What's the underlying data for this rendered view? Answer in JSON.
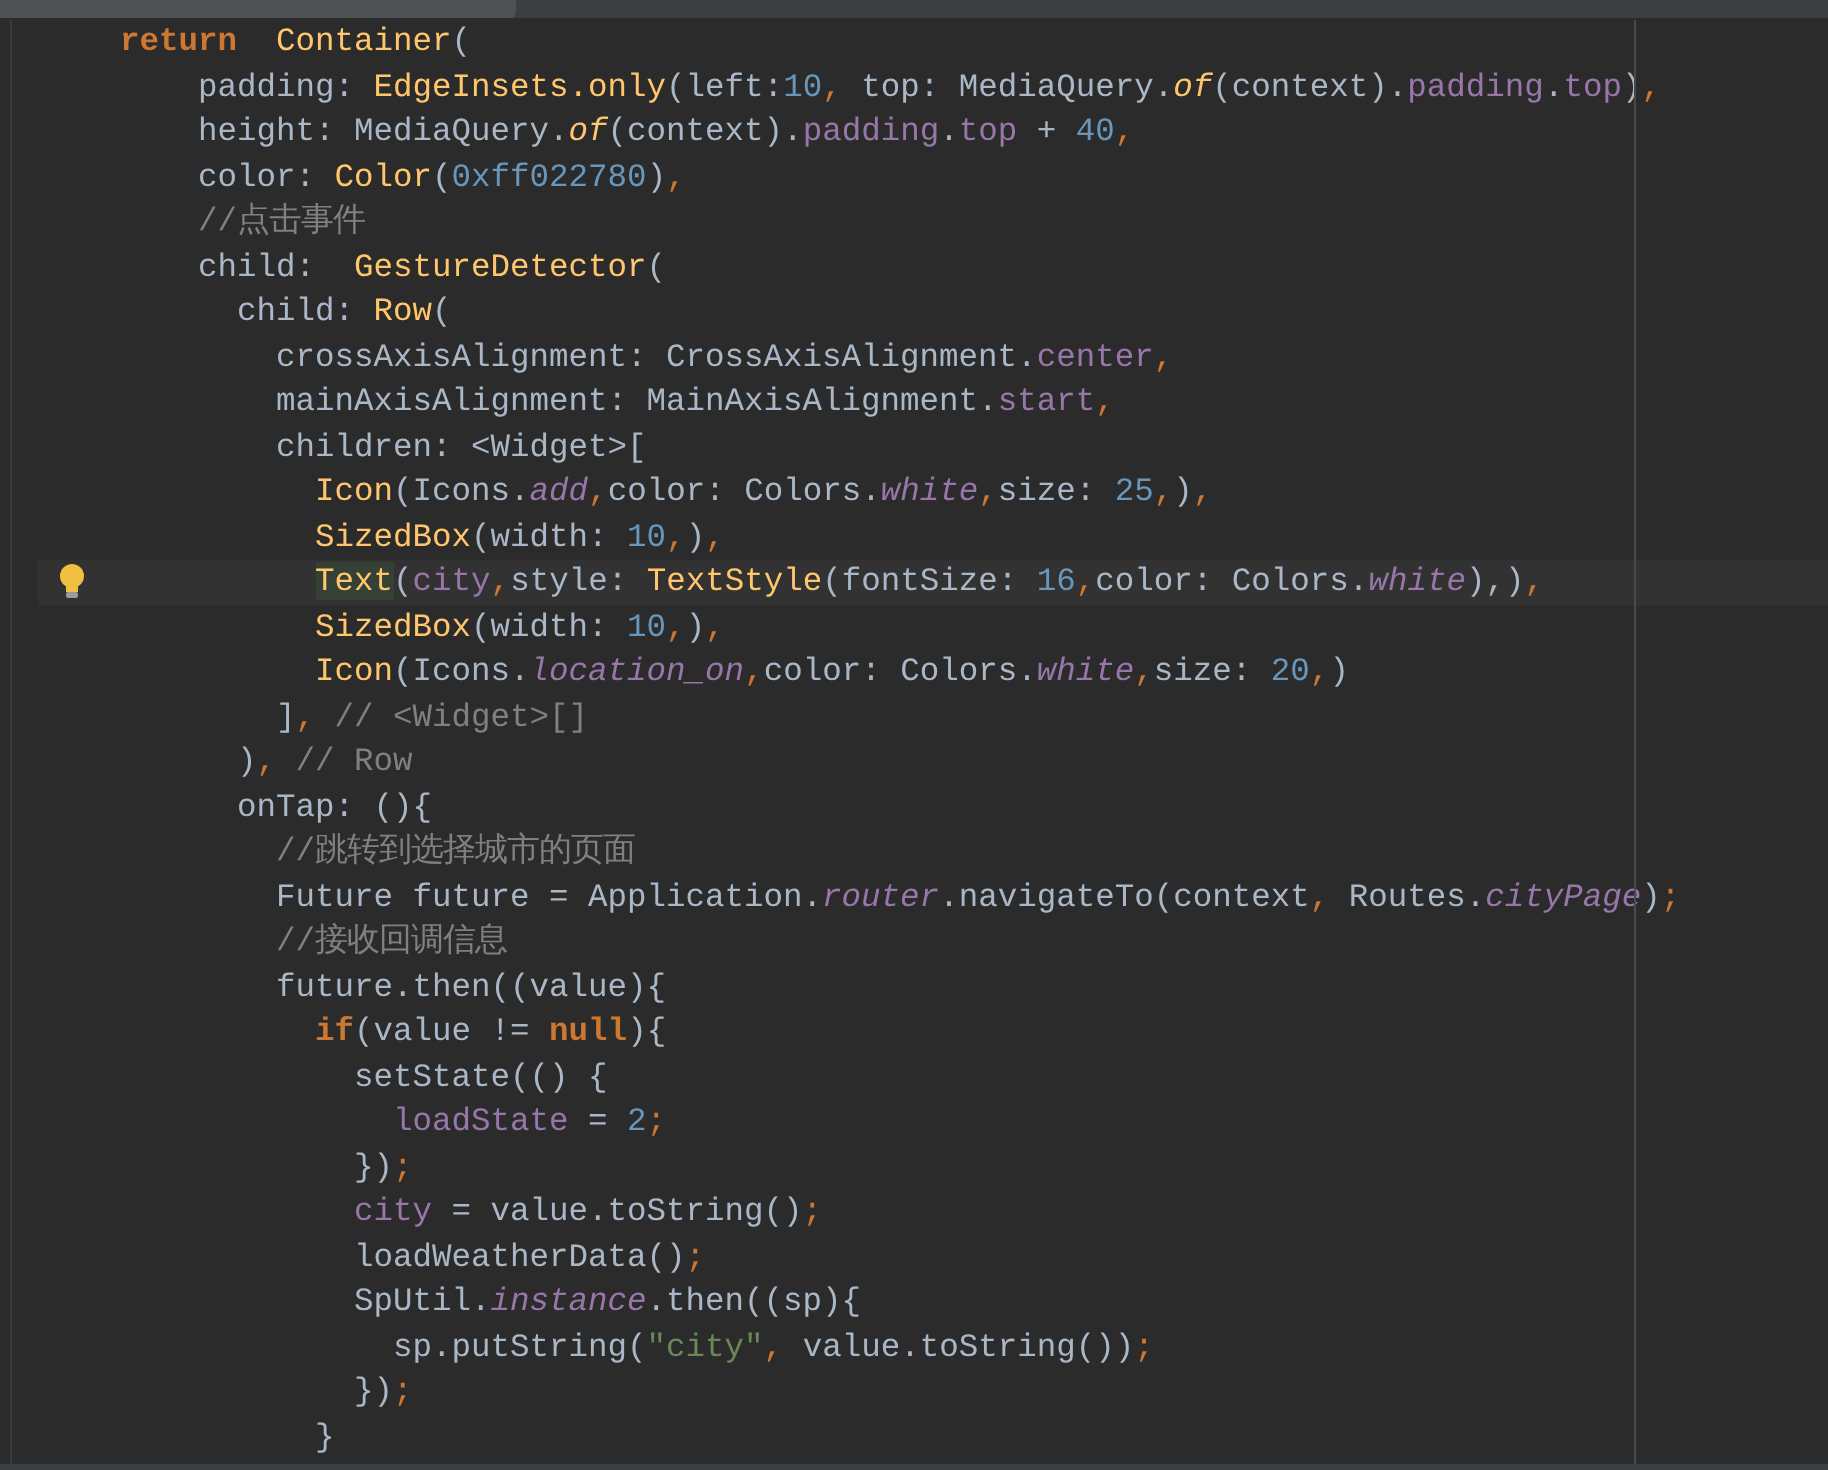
{
  "editor": {
    "lines": [
      {
        "current": false,
        "tokens": [
          {
            "kind": "keyword",
            "text": "    return"
          },
          {
            "kind": "class",
            "text": "  Container"
          },
          {
            "kind": "plain",
            "text": "("
          }
        ]
      },
      {
        "current": false,
        "tokens": [
          {
            "kind": "plain",
            "text": "        padding: "
          },
          {
            "kind": "class",
            "text": "EdgeInsets.only"
          },
          {
            "kind": "plain",
            "text": "(left:"
          },
          {
            "kind": "number",
            "text": "10"
          },
          {
            "kind": "punct",
            "text": ","
          },
          {
            "kind": "plain",
            "text": " top: MediaQuery."
          },
          {
            "kind": "method",
            "text": "of"
          },
          {
            "kind": "plain",
            "text": "(context)."
          },
          {
            "kind": "field",
            "text": "padding"
          },
          {
            "kind": "plain",
            "text": "."
          },
          {
            "kind": "field",
            "text": "top"
          },
          {
            "kind": "plain",
            "text": ")"
          },
          {
            "kind": "punct",
            "text": ","
          }
        ]
      },
      {
        "current": false,
        "tokens": [
          {
            "kind": "plain",
            "text": "        height: MediaQuery."
          },
          {
            "kind": "method",
            "text": "of"
          },
          {
            "kind": "plain",
            "text": "(context)."
          },
          {
            "kind": "field",
            "text": "padding"
          },
          {
            "kind": "plain",
            "text": "."
          },
          {
            "kind": "field",
            "text": "top"
          },
          {
            "kind": "plain",
            "text": " + "
          },
          {
            "kind": "number",
            "text": "40"
          },
          {
            "kind": "punct",
            "text": ","
          }
        ]
      },
      {
        "current": false,
        "tokens": [
          {
            "kind": "plain",
            "text": "        color: "
          },
          {
            "kind": "class",
            "text": "Color"
          },
          {
            "kind": "plain",
            "text": "("
          },
          {
            "kind": "number",
            "text": "0xff022780"
          },
          {
            "kind": "plain",
            "text": ")"
          },
          {
            "kind": "punct",
            "text": ","
          }
        ]
      },
      {
        "current": false,
        "tokens": [
          {
            "kind": "comment",
            "text": "        //点击事件"
          }
        ]
      },
      {
        "current": false,
        "tokens": [
          {
            "kind": "plain",
            "text": "        child:  "
          },
          {
            "kind": "class",
            "text": "GestureDetector"
          },
          {
            "kind": "plain",
            "text": "("
          }
        ]
      },
      {
        "current": false,
        "tokens": [
          {
            "kind": "plain",
            "text": "          child: "
          },
          {
            "kind": "class",
            "text": "Row"
          },
          {
            "kind": "plain",
            "text": "("
          }
        ]
      },
      {
        "current": false,
        "tokens": [
          {
            "kind": "plain",
            "text": "            crossAxisAlignment: CrossAxisAlignment."
          },
          {
            "kind": "field",
            "text": "center"
          },
          {
            "kind": "punct",
            "text": ","
          }
        ]
      },
      {
        "current": false,
        "tokens": [
          {
            "kind": "plain",
            "text": "            mainAxisAlignment: MainAxisAlignment."
          },
          {
            "kind": "field",
            "text": "start"
          },
          {
            "kind": "punct",
            "text": ","
          }
        ]
      },
      {
        "current": false,
        "tokens": [
          {
            "kind": "plain",
            "text": "            children: <Widget>["
          }
        ]
      },
      {
        "current": false,
        "tokens": [
          {
            "kind": "class",
            "text": "              Icon"
          },
          {
            "kind": "plain",
            "text": "(Icons."
          },
          {
            "kind": "static",
            "text": "add"
          },
          {
            "kind": "punct",
            "text": ","
          },
          {
            "kind": "plain",
            "text": "color: Colors."
          },
          {
            "kind": "static",
            "text": "white"
          },
          {
            "kind": "punct",
            "text": ","
          },
          {
            "kind": "plain",
            "text": "size: "
          },
          {
            "kind": "number",
            "text": "25"
          },
          {
            "kind": "punct",
            "text": ","
          },
          {
            "kind": "plain",
            "text": ")"
          },
          {
            "kind": "punct",
            "text": ","
          }
        ]
      },
      {
        "current": false,
        "tokens": [
          {
            "kind": "class",
            "text": "              SizedBox"
          },
          {
            "kind": "plain",
            "text": "(width: "
          },
          {
            "kind": "number",
            "text": "10"
          },
          {
            "kind": "punct",
            "text": ","
          },
          {
            "kind": "plain",
            "text": ")"
          },
          {
            "kind": "punct",
            "text": ","
          }
        ]
      },
      {
        "current": true,
        "tokens": [
          {
            "kind": "matched",
            "text": "              Text"
          },
          {
            "kind": "plain",
            "text": "("
          },
          {
            "kind": "field",
            "text": "city"
          },
          {
            "kind": "punct",
            "text": ","
          },
          {
            "kind": "plain",
            "text": "style: "
          },
          {
            "kind": "class",
            "text": "TextStyle"
          },
          {
            "kind": "plain",
            "text": "(fontSize: "
          },
          {
            "kind": "number",
            "text": "16"
          },
          {
            "kind": "punct",
            "text": ","
          },
          {
            "kind": "plain",
            "text": "color: Colors."
          },
          {
            "kind": "static",
            "text": "white"
          },
          {
            "kind": "plain",
            "text": "),)"
          },
          {
            "kind": "punct",
            "text": ","
          }
        ]
      },
      {
        "current": false,
        "tokens": [
          {
            "kind": "class",
            "text": "              SizedBox"
          },
          {
            "kind": "plain",
            "text": "(width: "
          },
          {
            "kind": "number",
            "text": "10"
          },
          {
            "kind": "punct",
            "text": ","
          },
          {
            "kind": "plain",
            "text": ")"
          },
          {
            "kind": "punct",
            "text": ","
          }
        ]
      },
      {
        "current": false,
        "tokens": [
          {
            "kind": "class",
            "text": "              Icon"
          },
          {
            "kind": "plain",
            "text": "(Icons."
          },
          {
            "kind": "static",
            "text": "location_on"
          },
          {
            "kind": "punct",
            "text": ","
          },
          {
            "kind": "plain",
            "text": "color: Colors."
          },
          {
            "kind": "static",
            "text": "white"
          },
          {
            "kind": "punct",
            "text": ","
          },
          {
            "kind": "plain",
            "text": "size: "
          },
          {
            "kind": "number",
            "text": "20"
          },
          {
            "kind": "punct",
            "text": ","
          },
          {
            "kind": "plain",
            "text": ")"
          }
        ]
      },
      {
        "current": false,
        "tokens": [
          {
            "kind": "plain",
            "text": "            ]"
          },
          {
            "kind": "punct",
            "text": ","
          },
          {
            "kind": "comment",
            "text": " // <Widget>[]"
          }
        ]
      },
      {
        "current": false,
        "tokens": [
          {
            "kind": "plain",
            "text": "          )"
          },
          {
            "kind": "punct",
            "text": ","
          },
          {
            "kind": "comment",
            "text": " // Row"
          }
        ]
      },
      {
        "current": false,
        "tokens": [
          {
            "kind": "plain",
            "text": "          onTap: (){"
          }
        ]
      },
      {
        "current": false,
        "tokens": [
          {
            "kind": "comment",
            "text": "            //跳转到选择城市的页面"
          }
        ]
      },
      {
        "current": false,
        "tokens": [
          {
            "kind": "plain",
            "text": "            Future future = Application."
          },
          {
            "kind": "static",
            "text": "router"
          },
          {
            "kind": "plain",
            "text": ".navigateTo(context"
          },
          {
            "kind": "punct",
            "text": ","
          },
          {
            "kind": "plain",
            "text": " Routes."
          },
          {
            "kind": "static",
            "text": "cityPage"
          },
          {
            "kind": "plain",
            "text": ")"
          },
          {
            "kind": "punct",
            "text": ";"
          }
        ]
      },
      {
        "current": false,
        "tokens": [
          {
            "kind": "comment",
            "text": "            //接收回调信息"
          }
        ]
      },
      {
        "current": false,
        "tokens": [
          {
            "kind": "plain",
            "text": "            future.then((value){"
          }
        ]
      },
      {
        "current": false,
        "tokens": [
          {
            "kind": "keyword",
            "text": "              if"
          },
          {
            "kind": "plain",
            "text": "(value != "
          },
          {
            "kind": "keyword",
            "text": "null"
          },
          {
            "kind": "plain",
            "text": "){"
          }
        ]
      },
      {
        "current": false,
        "tokens": [
          {
            "kind": "plain",
            "text": "                setState(() {"
          }
        ]
      },
      {
        "current": false,
        "tokens": [
          {
            "kind": "field",
            "text": "                  loadState"
          },
          {
            "kind": "plain",
            "text": " = "
          },
          {
            "kind": "number",
            "text": "2"
          },
          {
            "kind": "punct",
            "text": ";"
          }
        ]
      },
      {
        "current": false,
        "tokens": [
          {
            "kind": "plain",
            "text": "                })"
          },
          {
            "kind": "punct",
            "text": ";"
          }
        ]
      },
      {
        "current": false,
        "tokens": [
          {
            "kind": "field",
            "text": "                city"
          },
          {
            "kind": "plain",
            "text": " = value.toString()"
          },
          {
            "kind": "punct",
            "text": ";"
          }
        ]
      },
      {
        "current": false,
        "tokens": [
          {
            "kind": "plain",
            "text": "                loadWeatherData()"
          },
          {
            "kind": "punct",
            "text": ";"
          }
        ]
      },
      {
        "current": false,
        "tokens": [
          {
            "kind": "plain",
            "text": "                SpUtil."
          },
          {
            "kind": "static",
            "text": "instance"
          },
          {
            "kind": "plain",
            "text": ".then((sp){"
          }
        ]
      },
      {
        "current": false,
        "tokens": [
          {
            "kind": "plain",
            "text": "                  sp.putString("
          },
          {
            "kind": "string",
            "text": "\"city\""
          },
          {
            "kind": "punct",
            "text": ","
          },
          {
            "kind": "plain",
            "text": " value.toString())"
          },
          {
            "kind": "punct",
            "text": ";"
          }
        ]
      },
      {
        "current": false,
        "tokens": [
          {
            "kind": "plain",
            "text": "                })"
          },
          {
            "kind": "punct",
            "text": ";"
          }
        ]
      },
      {
        "current": false,
        "tokens": [
          {
            "kind": "plain",
            "text": "              }"
          }
        ]
      }
    ]
  }
}
